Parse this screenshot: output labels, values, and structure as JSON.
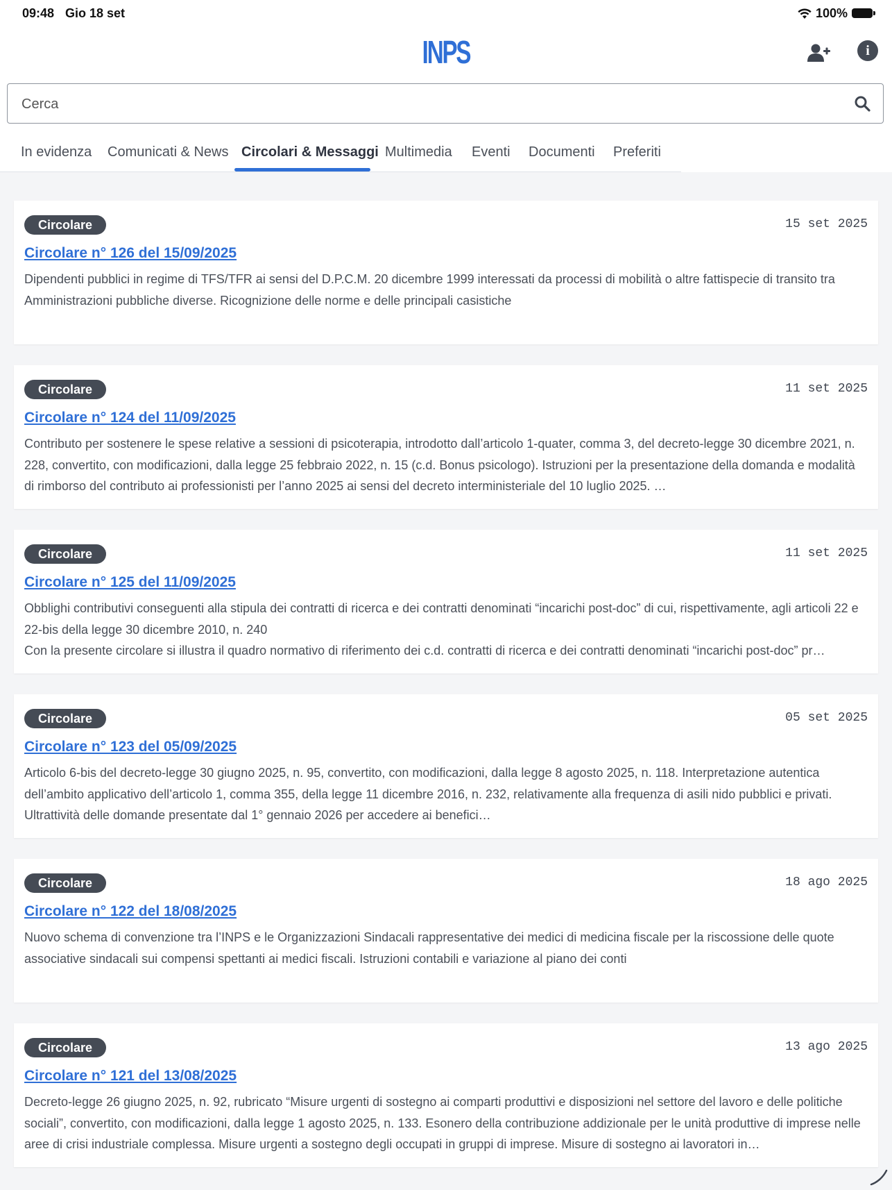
{
  "status_bar": {
    "time": "09:48",
    "date": "Gio 18 set",
    "battery": "100%",
    "wifi_icon": "wifi-icon",
    "battery_icon": "battery-icon"
  },
  "header": {
    "logo_text": "INPS",
    "add_user_icon": "add-user-icon",
    "info_icon": "info-icon",
    "info_glyph": "i"
  },
  "search": {
    "placeholder": "Cerca",
    "value": "",
    "icon": "search-icon"
  },
  "tabs": [
    {
      "label": "In evidenza",
      "active": false
    },
    {
      "label": "Comunicati & News",
      "active": false
    },
    {
      "label": "Circolari & Messaggi",
      "active": true
    },
    {
      "label": "Multimedia",
      "active": false
    },
    {
      "label": "Eventi",
      "active": false
    },
    {
      "label": "Documenti",
      "active": false
    },
    {
      "label": "Preferiti",
      "active": false
    }
  ],
  "items": [
    {
      "badge": "Circolare",
      "date": "15 set 2025",
      "title": "Circolare n° 126 del 15/09/2025",
      "description": "Dipendenti pubblici in regime di TFS/TFR ai sensi del D.P.C.M. 20 dicembre 1999 interessati da processi di mobilità o altre fattispecie di transito tra Amministrazioni pubbliche diverse. Ricognizione delle norme e delle principali casistiche"
    },
    {
      "badge": "Circolare",
      "date": "11 set 2025",
      "title": "Circolare n° 124 del 11/09/2025",
      "description": "Contributo per sostenere le spese relative a sessioni di psicoterapia, introdotto dall’articolo 1-quater, comma 3, del decreto-legge 30 dicembre 2021, n. 228, convertito, con modificazioni, dalla legge 25 febbraio 2022, n. 15 (c.d. Bonus psicologo). Istruzioni per la presentazione della domanda e modalità di rimborso del contributo ai professionisti per l’anno 2025 ai sensi del decreto interministeriale del 10 luglio 2025. …"
    },
    {
      "badge": "Circolare",
      "date": "11 set 2025",
      "title": "Circolare n° 125 del 11/09/2025",
      "description": "Obblighi contributivi conseguenti alla stipula dei contratti di ricerca e dei contratti denominati “incarichi post-doc” di cui, rispettivamente, agli articoli 22 e 22-bis della legge 30 dicembre 2010, n. 240\nCon la presente circolare si illustra il quadro normativo di riferimento dei c.d. contratti di ricerca e dei contratti denominati “incarichi post-doc” pr…"
    },
    {
      "badge": "Circolare",
      "date": "05 set 2025",
      "title": "Circolare n° 123 del 05/09/2025",
      "description": "Articolo 6-bis del decreto-legge 30 giugno 2025, n. 95, convertito, con modificazioni, dalla legge 8 agosto 2025, n. 118. Interpretazione autentica dell’ambito applicativo dell’articolo 1, comma 355, della legge 11 dicembre 2016, n. 232, relativamente alla frequenza di asili nido pubblici e privati. Ultrattività delle domande presentate dal 1° gennaio 2026 per accedere ai benefici…"
    },
    {
      "badge": "Circolare",
      "date": "18 ago 2025",
      "title": "Circolare n° 122 del 18/08/2025",
      "description": "Nuovo schema di convenzione tra l’INPS e le Organizzazioni Sindacali rappresentative dei medici di medicina fiscale per la riscossione delle quote associative sindacali sui compensi spettanti ai medici fiscali. Istruzioni contabili e variazione al piano dei conti"
    },
    {
      "badge": "Circolare",
      "date": "13 ago 2025",
      "title": "Circolare n° 121 del 13/08/2025",
      "description": "Decreto-legge 26 giugno 2025, n. 92, rubricato “Misure urgenti di sostegno ai comparti produttivi e disposizioni nel settore del lavoro e delle politiche sociali”, convertito, con modificazioni, dalla legge 1 agosto 2025, n. 133. Esonero della contribuzione addizionale per le unità produttive di imprese nelle aree di crisi industriale complessa. Misure urgenti a sostegno degli occupati in gruppi di imprese. Misure di sostegno ai lavoratori in…"
    }
  ],
  "colors": {
    "brand_blue": "#2f6fd6",
    "badge_bg": "#454b55",
    "background": "#f4f5f7",
    "card": "#ffffff"
  }
}
